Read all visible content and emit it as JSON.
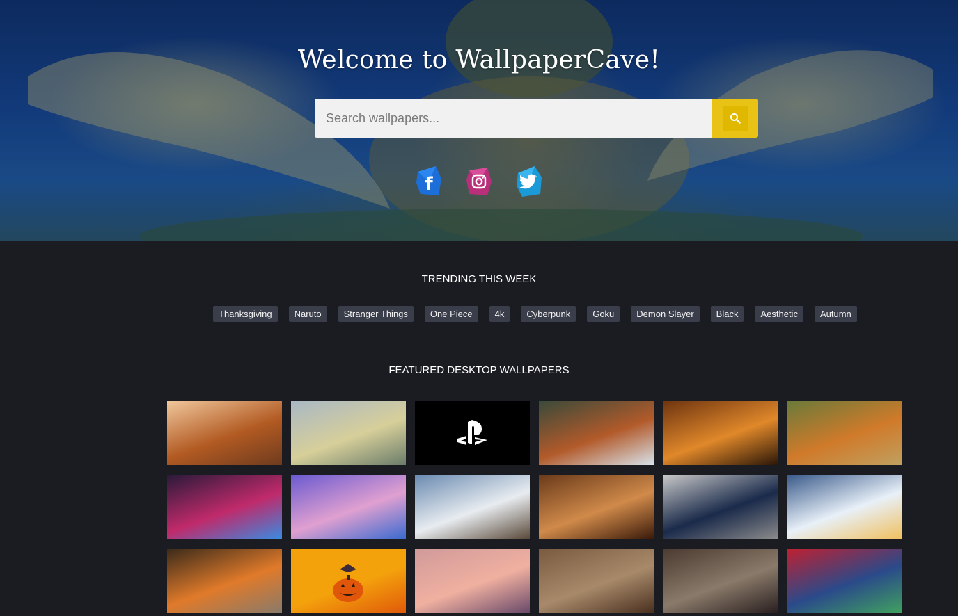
{
  "hero": {
    "title": "Welcome to WallpaperCave!",
    "search_placeholder": "Search wallpapers...",
    "search_icon": "search-icon",
    "accent": "#e8c215",
    "socials": [
      {
        "name": "facebook-icon",
        "color": "#1877f2"
      },
      {
        "name": "instagram-icon",
        "color": "#c13584"
      },
      {
        "name": "twitter-icon",
        "color": "#1da1f2"
      }
    ]
  },
  "trending": {
    "title": "TRENDING THIS WEEK",
    "tags": [
      "Thanksgiving",
      "Naruto",
      "Stranger Things",
      "One Piece",
      "4k",
      "Cyberpunk",
      "Goku",
      "Demon Slayer",
      "Black",
      "Aesthetic",
      "Autumn"
    ]
  },
  "featured": {
    "title": "FEATURED DESKTOP WALLPAPERS",
    "wallpapers": [
      {
        "name": "wallpaper-autumn-forest-path",
        "colors": [
          "#f0c79c",
          "#b25a22",
          "#6e3b1e"
        ]
      },
      {
        "name": "wallpaper-birds-on-branch",
        "colors": [
          "#a9b8c4",
          "#d7cf9a",
          "#6a7c6a"
        ]
      },
      {
        "name": "wallpaper-playstation-logo",
        "colors": [
          "#000000",
          "#000000",
          "#000000"
        ]
      },
      {
        "name": "wallpaper-aerial-autumn-road",
        "colors": [
          "#3a4a3a",
          "#b25a2a",
          "#d8e2ea"
        ]
      },
      {
        "name": "wallpaper-sunset-trees",
        "colors": [
          "#6e3410",
          "#e0882a",
          "#2a1608"
        ]
      },
      {
        "name": "wallpaper-pumpkins-hay",
        "colors": [
          "#6a7a3a",
          "#d07a2a",
          "#c0a060"
        ]
      },
      {
        "name": "wallpaper-neon-city-street",
        "colors": [
          "#2a1a3a",
          "#c02a6a",
          "#3a8ae0"
        ]
      },
      {
        "name": "wallpaper-anime-heroine",
        "colors": [
          "#6a5ad0",
          "#e0a0d0",
          "#3a6ad0"
        ]
      },
      {
        "name": "wallpaper-snowy-mountain",
        "colors": [
          "#6a8ab0",
          "#e8ecf0",
          "#5a4a3a"
        ]
      },
      {
        "name": "wallpaper-autumn-gourds",
        "colors": [
          "#6a3a1a",
          "#d08a4a",
          "#3a1a0a"
        ]
      },
      {
        "name": "wallpaper-formula-one-car",
        "colors": [
          "#c8c8c8",
          "#1a2a4a",
          "#8a8a8a"
        ]
      },
      {
        "name": "wallpaper-winter-forest-sunset",
        "colors": [
          "#3a5a8a",
          "#e8f0f8",
          "#f0c060"
        ]
      },
      {
        "name": "wallpaper-pumpkin-market",
        "colors": [
          "#3a2a1a",
          "#e07a2a",
          "#8a7a6a"
        ]
      },
      {
        "name": "wallpaper-halloween-pumpkin",
        "colors": [
          "#f4a20c",
          "#f4a20c",
          "#e05a0a"
        ]
      },
      {
        "name": "wallpaper-pink-sunset-window",
        "colors": [
          "#d09a9a",
          "#f0b0a0",
          "#6a4a6a"
        ]
      },
      {
        "name": "wallpaper-dry-leaves",
        "colors": [
          "#7a5a40",
          "#a88a6a",
          "#4a3020"
        ]
      },
      {
        "name": "wallpaper-stacked-logs",
        "colors": [
          "#4a3a30",
          "#8a7a6a",
          "#2a2020"
        ]
      },
      {
        "name": "wallpaper-kaws-art",
        "colors": [
          "#c02030",
          "#2a4a8a",
          "#40a060"
        ]
      }
    ]
  }
}
